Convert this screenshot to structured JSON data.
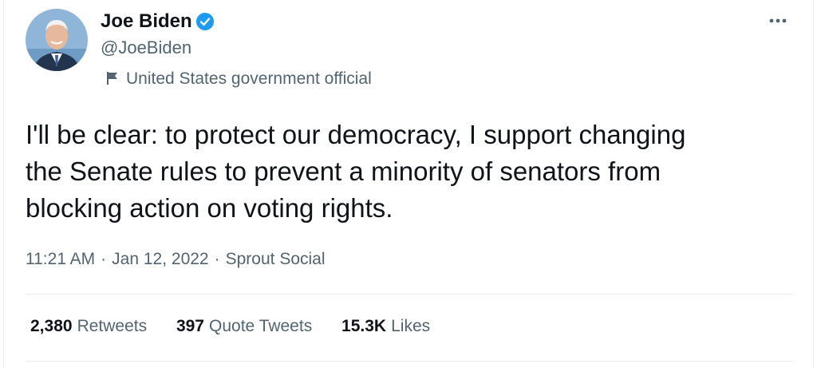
{
  "author": {
    "display_name": "Joe Biden",
    "handle": "@JoeBiden",
    "label": "United States government official"
  },
  "tweet": {
    "text": "I'll be clear: to protect our democracy, I support changing\nthe Senate rules to prevent a minority of senators from\nblocking action on voting rights.",
    "time": "11:21 AM",
    "date": "Jan 12, 2022",
    "source": "Sprout Social",
    "separator": "·"
  },
  "stats": [
    {
      "count": "2,380",
      "label": "Retweets"
    },
    {
      "count": "397",
      "label": "Quote Tweets"
    },
    {
      "count": "15.3K",
      "label": "Likes"
    }
  ],
  "icons": {
    "verified": "verified-badge-icon",
    "label_flag": "flag-icon",
    "more": "more-options-icon"
  },
  "colors": {
    "text": "#0f1419",
    "secondary_text": "#536471",
    "verified_blue": "#1d9bf0",
    "divider": "#e6ecf0"
  }
}
